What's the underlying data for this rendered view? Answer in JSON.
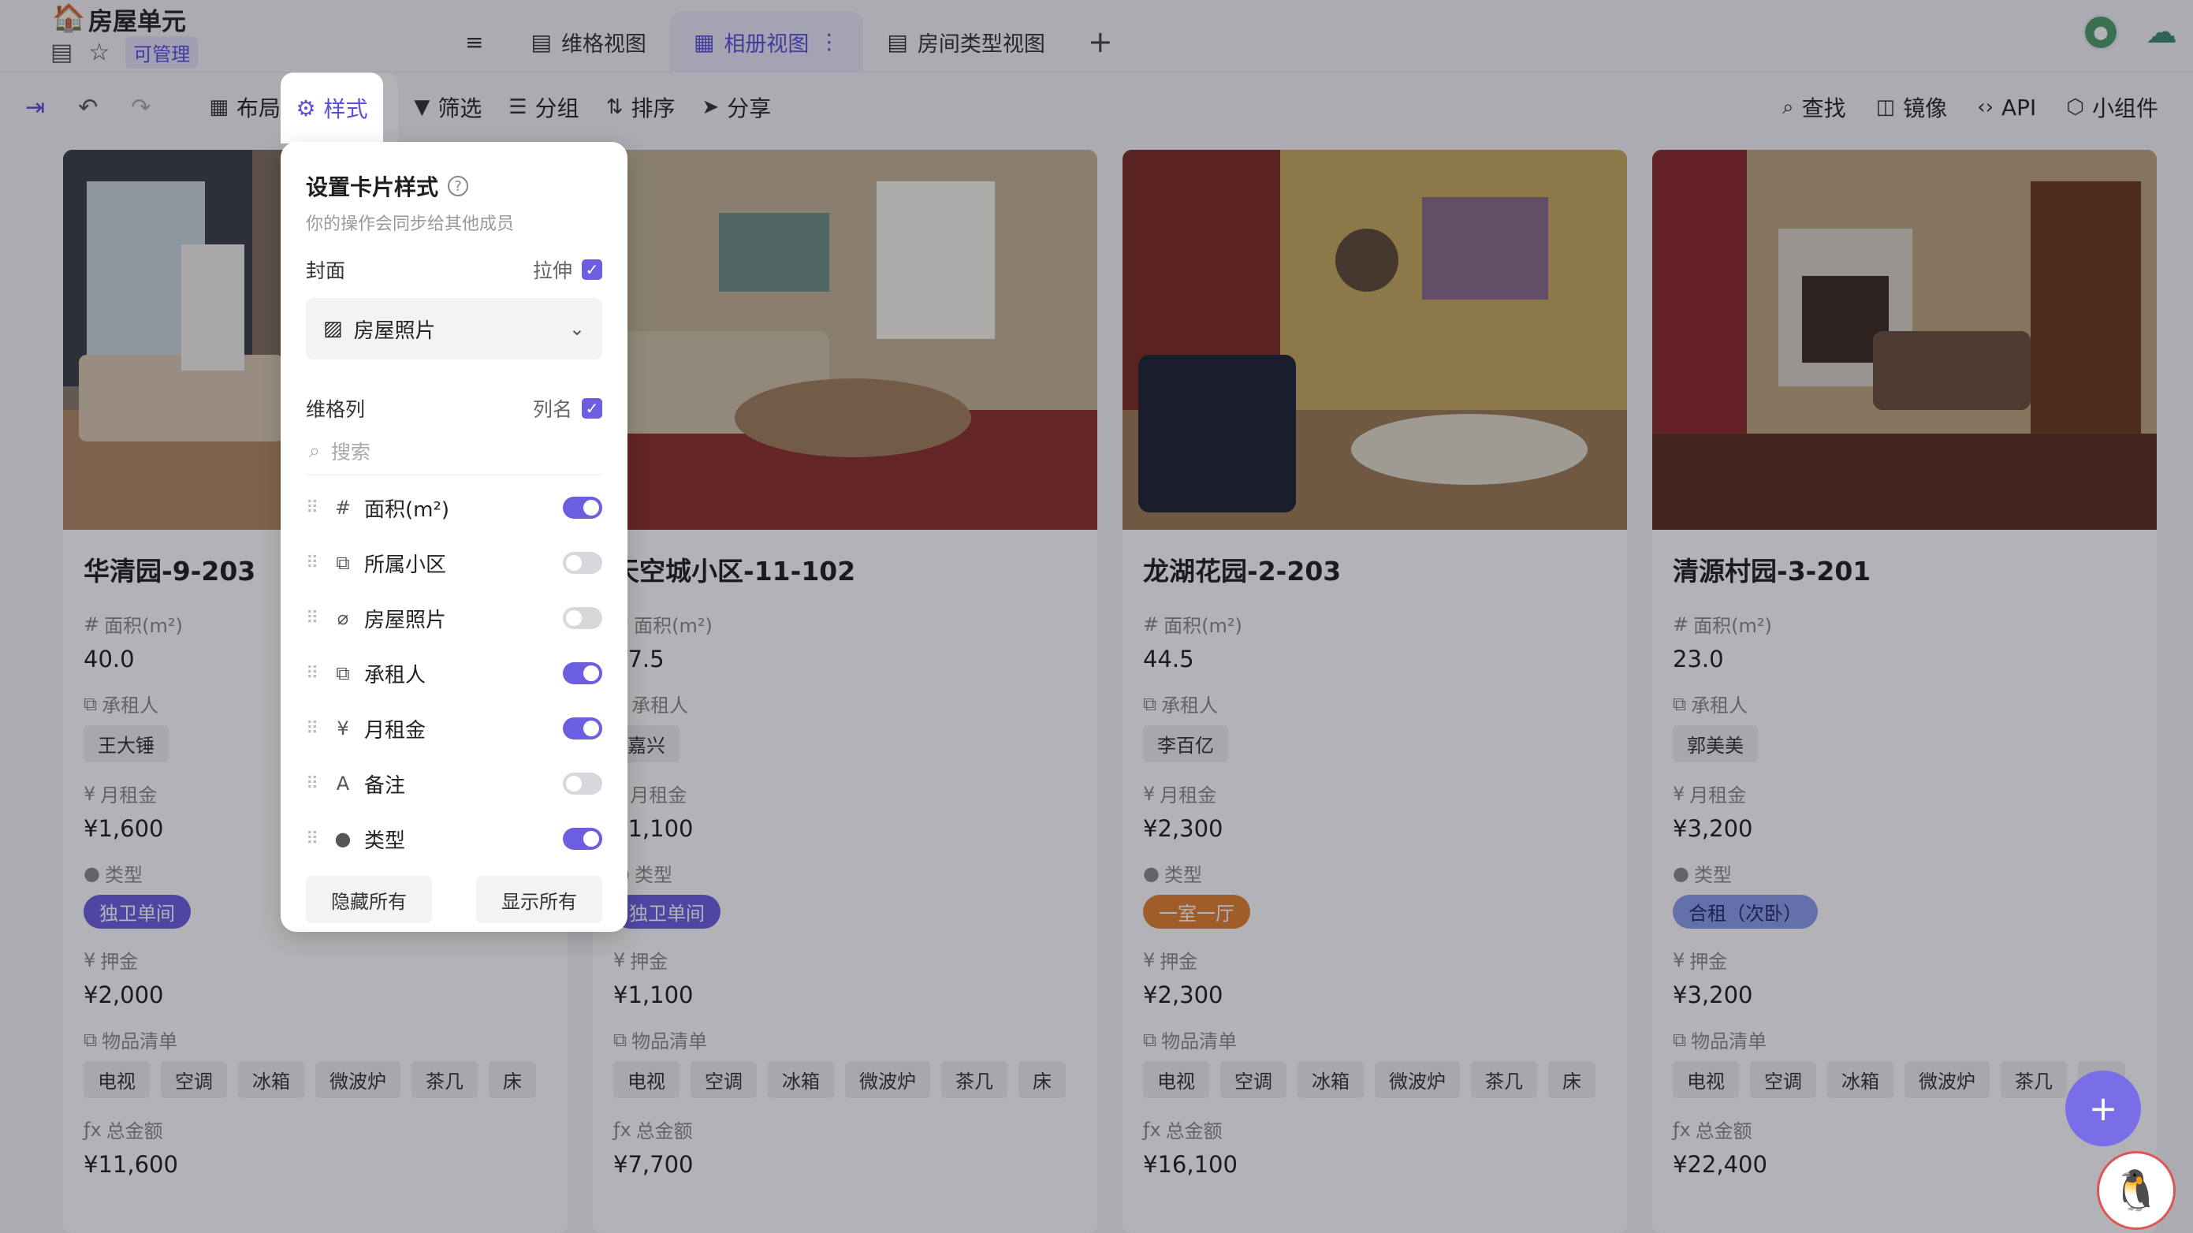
{
  "header": {
    "title": "房屋单元",
    "badge": "可管理",
    "tabs": [
      {
        "label": "维格视图",
        "icon": "grid-view-icon"
      },
      {
        "label": "相册视图",
        "icon": "gallery-view-icon",
        "active": true
      },
      {
        "label": "房间类型视图",
        "icon": "grid-view-icon"
      }
    ]
  },
  "toolbar": {
    "left": [
      {
        "label": "布局",
        "icon": "layout-icon"
      },
      {
        "label": "样式",
        "icon": "gear-icon"
      },
      {
        "label": "筛选",
        "icon": "filter-icon"
      },
      {
        "label": "分组",
        "icon": "group-icon"
      },
      {
        "label": "排序",
        "icon": "sort-icon"
      },
      {
        "label": "分享",
        "icon": "share-icon"
      }
    ],
    "right": [
      {
        "label": "查找",
        "icon": "search-icon"
      },
      {
        "label": "镜像",
        "icon": "mirror-icon"
      },
      {
        "label": "API",
        "icon": "code-icon"
      },
      {
        "label": "小组件",
        "icon": "widget-icon"
      }
    ]
  },
  "popover": {
    "title": "设置卡片样式",
    "subtitle": "你的操作会同步给其他成员",
    "cover_label": "封面",
    "stretch_label": "拉伸",
    "cover_value": "房屋照片",
    "columns_label": "维格列",
    "colname_label": "列名",
    "search_placeholder": "搜索",
    "columns": [
      {
        "label": "面积(m²)",
        "icon": "#",
        "on": true
      },
      {
        "label": "所属小区",
        "icon": "⧉",
        "on": false
      },
      {
        "label": "房屋照片",
        "icon": "⌀",
        "on": false
      },
      {
        "label": "承租人",
        "icon": "⧉",
        "on": true
      },
      {
        "label": "月租金",
        "icon": "¥",
        "on": true
      },
      {
        "label": "备注",
        "icon": "A",
        "on": false
      },
      {
        "label": "类型",
        "icon": "●",
        "on": true
      }
    ],
    "hide_all": "隐藏所有",
    "show_all": "显示所有"
  },
  "labels": {
    "area": "面积(m²)",
    "tenant": "承租人",
    "rent": "月租金",
    "type": "类型",
    "deposit": "押金",
    "items": "物品清单",
    "total": "总金额"
  },
  "cards": [
    {
      "title": "华清园-9-203",
      "area": "40.0",
      "tenant": "王大锤",
      "rent": "¥1,600",
      "type": "独卫单间",
      "type_color": "#6b5fe0",
      "deposit": "¥2,000",
      "items": [
        "电视",
        "空调",
        "冰箱",
        "微波炉",
        "茶几",
        "床"
      ],
      "total": "¥11,600"
    },
    {
      "title": "天空城小区-11-102",
      "area": "37.5",
      "tenant": "嘉兴",
      "rent": "¥1,100",
      "type": "独卫单间",
      "type_color": "#6b5fe0",
      "deposit": "¥1,100",
      "items": [
        "电视",
        "空调",
        "冰箱",
        "微波炉",
        "茶几",
        "床"
      ],
      "total": "¥7,700"
    },
    {
      "title": "龙湖花园-2-203",
      "area": "44.5",
      "tenant": "李百亿",
      "rent": "¥2,300",
      "type": "一室一厅",
      "type_color": "#e0812f",
      "deposit": "¥2,300",
      "items": [
        "电视",
        "空调",
        "冰箱",
        "微波炉",
        "茶几",
        "床"
      ],
      "total": "¥16,100"
    },
    {
      "title": "清源村园-3-201",
      "area": "23.0",
      "tenant": "郭美美",
      "rent": "¥3,200",
      "type": "合租（次卧）",
      "type_color": "#7a8fe8",
      "deposit": "¥3,200",
      "items": [
        "电视",
        "空调",
        "冰箱",
        "微波炉",
        "茶几",
        "床"
      ],
      "total": "¥22,400"
    }
  ]
}
